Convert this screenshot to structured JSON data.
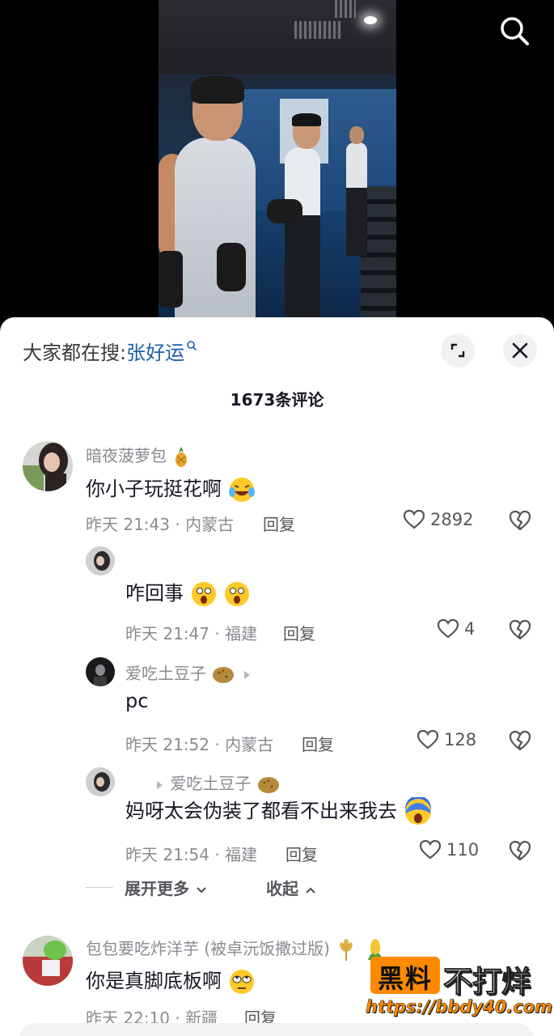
{
  "header": {
    "search_icon": "search-icon"
  },
  "sheet": {
    "search_prefix": "大家都在搜:",
    "search_keyword": "张好运",
    "comment_count_label": "1673条评论"
  },
  "comments": [
    {
      "username": "暗夜菠萝包",
      "username_emoji": "pineapple",
      "text": "你小子玩挺花啊",
      "text_emoji": "laughing-crying",
      "meta": "昨天 21:43 · 内蒙古",
      "reply_label": "回复",
      "likes": "2892"
    }
  ],
  "replies": [
    {
      "username": "",
      "text": "咋回事",
      "text_emoji": "shocked-face x2",
      "meta": "昨天 21:47 · 福建",
      "reply_label": "回复",
      "likes": "4"
    },
    {
      "username": "爱吃土豆子",
      "username_emoji": "potato",
      "text": "pc",
      "meta": "昨天 21:52 · 内蒙古",
      "reply_label": "回复",
      "likes": "128"
    },
    {
      "username": "",
      "reply_to": "爱吃土豆子",
      "reply_to_emoji": "potato",
      "text": "妈呀太会伪装了都看不出来我去",
      "text_emoji": "screaming-face",
      "meta": "昨天 21:54 · 福建",
      "reply_label": "回复",
      "likes": "110"
    }
  ],
  "thread_controls": {
    "expand_more": "展开更多",
    "collapse": "收起"
  },
  "comment2": {
    "username": "包包要吃炸洋芋 (被卓沅饭撒过版)",
    "username_emoji": "wheat, corn",
    "text": "你是真脚底板啊",
    "text_emoji": "rolling-eyes",
    "meta": "昨天 22:10 · 新疆",
    "reply_label": "回复"
  },
  "watermark": {
    "box": "黑料",
    "text": "不打烊",
    "url": "https://bbdy40.com"
  }
}
